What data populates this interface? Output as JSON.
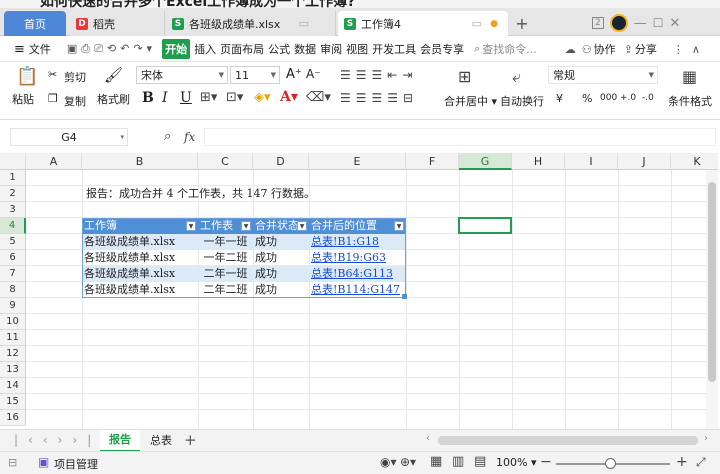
{
  "title_strip": "如何快速的合并多个Excel工作簿成为一个工作簿?",
  "tabs": [
    {
      "label": "首页"
    },
    {
      "label": "稻壳"
    },
    {
      "label": "各班级成绩单.xlsx"
    },
    {
      "label": "工作簿4"
    }
  ],
  "tabbar_badge": "2",
  "menu": {
    "file": "文件",
    "items": [
      "开始",
      "插入",
      "页面布局",
      "公式",
      "数据",
      "审阅",
      "视图",
      "开发工具",
      "会员专享"
    ],
    "search_placeholder": "查找命令...",
    "collab": "协作",
    "share": "分享"
  },
  "ribbon": {
    "paste": "粘贴",
    "cut": "剪切",
    "copy": "复制",
    "format_painter": "格式刷",
    "font_name": "宋体",
    "font_size": "11",
    "merge_center": "合并居中",
    "wrap_text": "自动换行",
    "number_format": "常规",
    "cond_format": "条件格式",
    "bold": "B",
    "italic": "I",
    "underline": "U",
    "grow": "A⁺",
    "shrink": "A⁻",
    "currency": "¥",
    "percent": "%",
    "thousands": "000",
    "inc_decimal": "+.0",
    "dec_decimal": "-.0"
  },
  "formula_bar": {
    "cell_ref": "G4",
    "fx": "fx",
    "content": ""
  },
  "columns": [
    "A",
    "B",
    "C",
    "D",
    "E",
    "F",
    "G",
    "H",
    "I",
    "J",
    "K"
  ],
  "rows": [
    "1",
    "2",
    "3",
    "4",
    "5",
    "6",
    "7",
    "8",
    "9",
    "10",
    "11",
    "12",
    "13",
    "14",
    "15",
    "16"
  ],
  "selected_cell": "G4",
  "report_text": "报告：成功合并 4 个工作表，共 147 行数据。",
  "table": {
    "headers": [
      "工作簿",
      "工作表",
      "合并状态",
      "合并后的位置"
    ],
    "rows": [
      [
        "各班级成绩单.xlsx",
        "一年一班",
        "成功",
        "总表!B1:G18"
      ],
      [
        "各班级成绩单.xlsx",
        "一年二班",
        "成功",
        "总表!B19:G63"
      ],
      [
        "各班级成绩单.xlsx",
        "二年一班",
        "成功",
        "总表!B64:G113"
      ],
      [
        "各班级成绩单.xlsx",
        "二年二班",
        "成功",
        "总表!B114:G147"
      ]
    ]
  },
  "sheet_tabs": [
    {
      "label": "报告",
      "active": true
    },
    {
      "label": "总表",
      "active": false
    }
  ],
  "status": {
    "project": "项目管理",
    "zoom": "100%"
  },
  "colors": {
    "accent_green": "#1e9e4e",
    "table_header": "#4f8fd6",
    "home_tab": "#4f87d8"
  }
}
